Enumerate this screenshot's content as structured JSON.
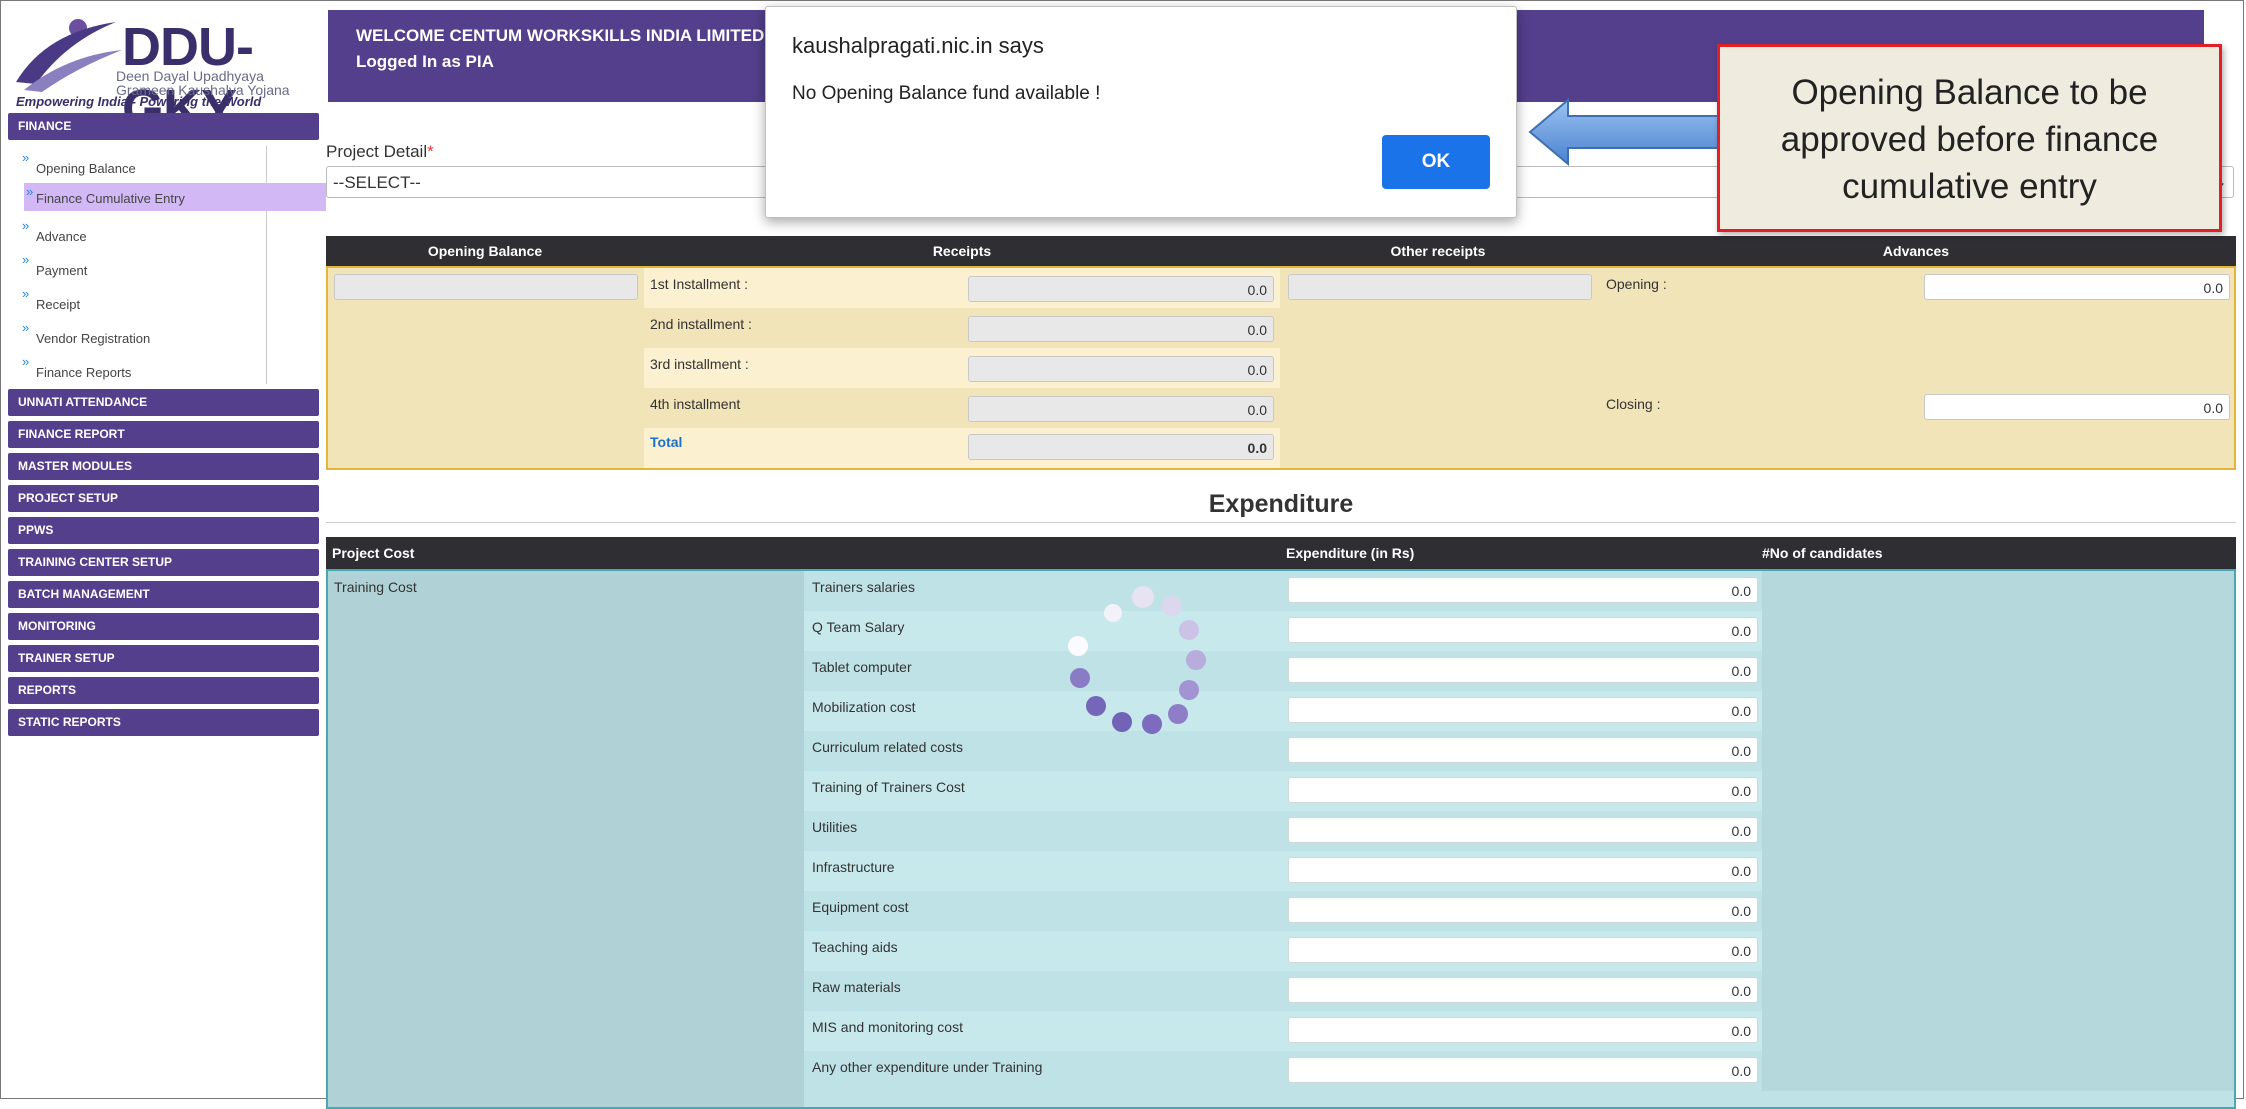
{
  "logo": {
    "title": "DDU-GKY",
    "subtitle1": "Deen Dayal Upadhyaya",
    "subtitle2": "Grameen Kaushalya Yojana",
    "tagline": "Empowering India - Powering the World"
  },
  "header": {
    "welcome": "WELCOME  CENTUM WORKSKILLS INDIA LIMITED",
    "logged_in": "Logged In as  PIA",
    "color": "#533f8c"
  },
  "sidebar": {
    "finance_section": "FINANCE",
    "finance_items": [
      {
        "label": "Opening Balance"
      },
      {
        "label": "Finance Cumulative Entry",
        "active": true
      },
      {
        "label": "Advance"
      },
      {
        "label": "Payment"
      },
      {
        "label": "Receipt"
      },
      {
        "label": "Vendor Registration"
      },
      {
        "label": "Finance Reports"
      }
    ],
    "sections": [
      "UNNATI ATTENDANCE",
      "FINANCE REPORT",
      "MASTER MODULES",
      "PROJECT SETUP",
      "PPWS",
      "TRAINING CENTER SETUP",
      "BATCH MANAGEMENT",
      "MONITORING",
      "TRAINER SETUP",
      "REPORTS",
      "STATIC REPORTS"
    ]
  },
  "project": {
    "label": "Project Detail",
    "required_mark": "*",
    "selected": "--SELECT--"
  },
  "receipts": {
    "headers": {
      "opening_balance": "Opening Balance",
      "receipts": "Receipts",
      "other_receipts": "Other receipts",
      "advances": "Advances"
    },
    "installments": [
      {
        "label": "1st Installment :",
        "value": "0.0"
      },
      {
        "label": "2nd installment :",
        "value": "0.0"
      },
      {
        "label": "3rd installment :",
        "value": "0.0"
      },
      {
        "label": "4th installment",
        "value": "0.0"
      }
    ],
    "total_label": "Total",
    "total_value": "0.0",
    "advances_opening_label": "Opening :",
    "advances_opening_value": "0.0",
    "advances_closing_label": "Closing :",
    "advances_closing_value": "0.0"
  },
  "expenditure": {
    "title": "Expenditure",
    "headers": {
      "project_cost": "Project Cost",
      "expenditure": "Expenditure (in Rs)",
      "candidates": "#No of candidates"
    },
    "category": "Training Cost",
    "rows": [
      {
        "label": "Trainers salaries",
        "value": "0.0"
      },
      {
        "label": "Q Team Salary",
        "value": "0.0"
      },
      {
        "label": "Tablet computer",
        "value": "0.0"
      },
      {
        "label": "Mobilization cost",
        "value": "0.0"
      },
      {
        "label": "Curriculum related costs",
        "value": "0.0"
      },
      {
        "label": "Training of Trainers Cost",
        "value": "0.0"
      },
      {
        "label": "Utilities",
        "value": "0.0"
      },
      {
        "label": "Infrastructure",
        "value": "0.0"
      },
      {
        "label": "Equipment cost",
        "value": "0.0"
      },
      {
        "label": "Teaching aids",
        "value": "0.0"
      },
      {
        "label": "Raw materials",
        "value": "0.0"
      },
      {
        "label": "MIS and monitoring cost",
        "value": "0.0"
      },
      {
        "label": "Any other expenditure under Training",
        "value": "0.0"
      }
    ]
  },
  "dialog": {
    "title": "kaushalpragati.nic.in says",
    "message": "No Opening Balance fund available !",
    "ok_label": "OK"
  },
  "annotation": {
    "text": "Opening Balance to be approved before finance cumulative entry"
  }
}
